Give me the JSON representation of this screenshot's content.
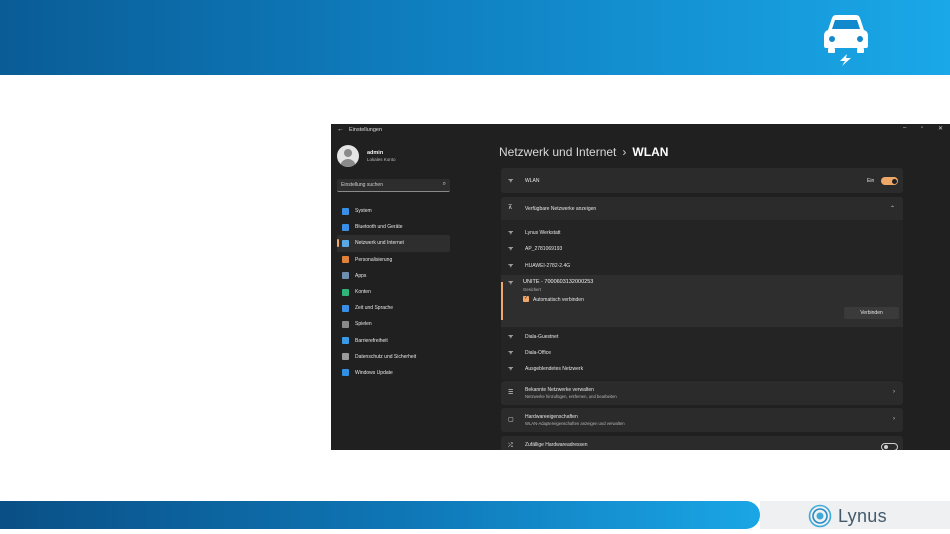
{
  "settings": {
    "window_title": "Einstellungen",
    "back_glyph": "←",
    "controls": {
      "minimize": "–",
      "maximize": "▫",
      "close": "✕"
    },
    "profile": {
      "name": "admin",
      "subtitle": "Lokales Konto"
    },
    "search": {
      "placeholder": "Einstellung suchen"
    },
    "nav": [
      {
        "label": "System",
        "icon": "monitor-icon",
        "color": "#3a8ee6"
      },
      {
        "label": "Bluetooth und Geräte",
        "icon": "bluetooth-icon",
        "color": "#3a8ee6"
      },
      {
        "label": "Netzwerk und Internet",
        "icon": "network-icon",
        "color": "#5aa9e6"
      },
      {
        "label": "Personalisierung",
        "icon": "brush-icon",
        "color": "#e0823a"
      },
      {
        "label": "Apps",
        "icon": "apps-icon",
        "color": "#6f8fb0"
      },
      {
        "label": "Konten",
        "icon": "person-icon",
        "color": "#2fb37a"
      },
      {
        "label": "Zeit und Sprache",
        "icon": "globe-clock-icon",
        "color": "#3a8ee6"
      },
      {
        "label": "Spielen",
        "icon": "gamepad-icon",
        "color": "#8a8a8a"
      },
      {
        "label": "Barrierefreiheit",
        "icon": "accessibility-icon",
        "color": "#3a9ae6"
      },
      {
        "label": "Datenschutz und Sicherheit",
        "icon": "shield-icon",
        "color": "#9a9a9a"
      },
      {
        "label": "Windows Update",
        "icon": "update-icon",
        "color": "#2f8fe0"
      }
    ],
    "active_nav_index": 2,
    "breadcrumb": {
      "parent": "Netzwerk und Internet",
      "separator": "›",
      "current": "WLAN"
    },
    "wlan_row": {
      "label": "WLAN",
      "state": "Ein",
      "on": true
    },
    "available": {
      "label": "Verfügbare Netzwerke anzeigen"
    },
    "networks": [
      {
        "name": "Lynus Werkstatt",
        "secured": true
      },
      {
        "name": "AP_2781069193",
        "secured": true
      },
      {
        "name": "HUAWEI-2782-2.4G",
        "secured": true
      }
    ],
    "selected_network": {
      "name": "UNITE - 7000603132000253",
      "status": "Gesichert",
      "auto_connect_label": "Automatisch verbinden",
      "auto_connect": true,
      "connect_button": "Verbinden"
    },
    "networks_after": [
      {
        "name": "Diala-Guestnet",
        "secured": false
      },
      {
        "name": "Diala-Office",
        "secured": false
      },
      {
        "name": "Ausgeblendetes Netzwerk",
        "secured": true
      }
    ],
    "known": {
      "label": "Bekannte Netzwerke verwalten",
      "sub": "Netzwerke hinzufügen, entfernen, und bearbeiten"
    },
    "hardware": {
      "label": "Hardwareeigenschaften",
      "sub": "WLAN-Adaptereigenschaften anzeigen und verwalten"
    },
    "random_mac": {
      "label": "Zufällige Hardwareadressen"
    }
  },
  "brand": {
    "name": "Lynus",
    "accent": "#1aa8e8"
  }
}
